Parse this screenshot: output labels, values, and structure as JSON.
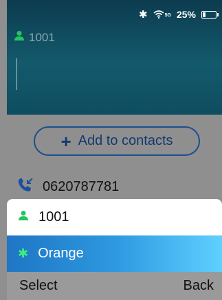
{
  "status_bar": {
    "bluetooth_icon": "bluetooth-icon",
    "network_label": "5G",
    "battery_percent_text": "25%",
    "battery_level": 0.25
  },
  "header": {
    "caller_icon": "person-icon",
    "caller_number": "1001"
  },
  "add_contacts": {
    "icon": "plus-icon",
    "label": "Add to contacts"
  },
  "call_entry": {
    "icon": "incoming-call-icon",
    "number": "0620787781"
  },
  "sheet": {
    "items": [
      {
        "icon": "person-icon",
        "label": "1001",
        "selected": false
      },
      {
        "icon": "bluetooth-icon",
        "label": "Orange",
        "selected": true
      }
    ]
  },
  "softkeys": {
    "left": "Select",
    "right": "Back"
  },
  "colors": {
    "header_bg": "#0f4d60",
    "accent_green": "#22c55e",
    "selection_gradient_start": "#1f76c4",
    "selection_gradient_end": "#5fd0ff",
    "button_outline": "#1b4f8f"
  }
}
